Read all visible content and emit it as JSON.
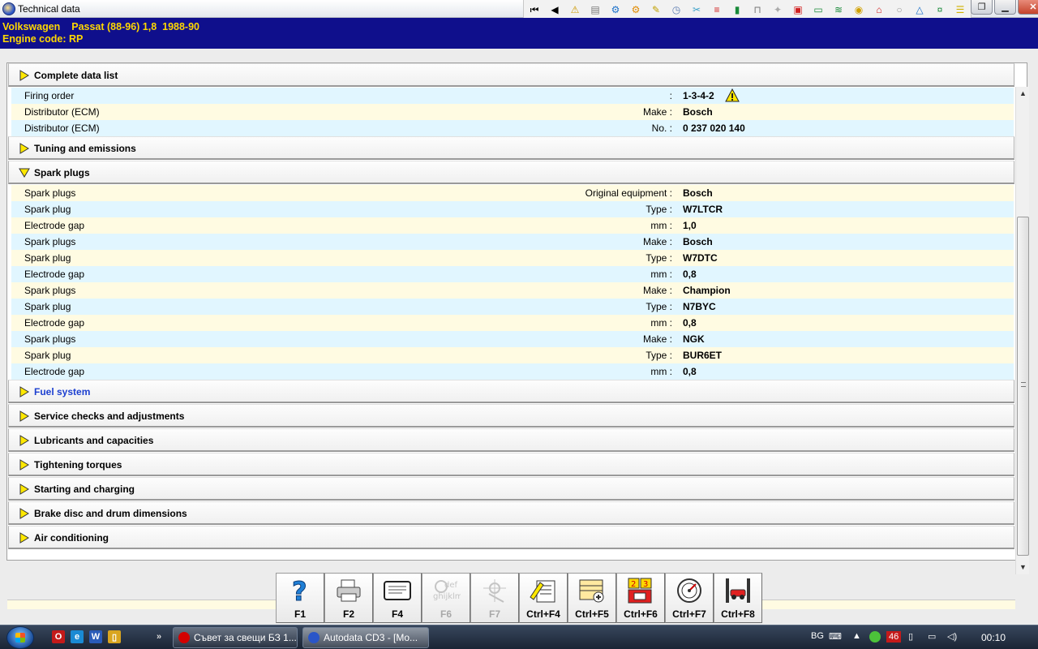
{
  "window": {
    "title": "Technical data"
  },
  "top_toolbar": {
    "buttons": [
      {
        "icon": "first-page-icon",
        "glyph": "⏮"
      },
      {
        "icon": "previous-icon",
        "glyph": "◀"
      },
      {
        "icon": "warning-triangle-icon",
        "glyph": "⚠"
      },
      {
        "icon": "page-icon",
        "glyph": "▤"
      },
      {
        "icon": "engine-icon",
        "glyph": "⚙"
      },
      {
        "icon": "gear-icon",
        "glyph": "⚙"
      },
      {
        "icon": "wrench-icon",
        "glyph": "✎"
      },
      {
        "icon": "clock-icon",
        "glyph": "◷"
      },
      {
        "icon": "tools-icon",
        "glyph": "✂"
      },
      {
        "icon": "belt-icon",
        "glyph": "≡"
      },
      {
        "icon": "battery-icon",
        "glyph": "▮"
      },
      {
        "icon": "lift-icon",
        "glyph": "⊓"
      },
      {
        "icon": "spark-plug-icon",
        "glyph": "✦"
      },
      {
        "icon": "diagnostics-icon",
        "glyph": "▣"
      },
      {
        "icon": "dashboard-icon",
        "glyph": "▭"
      },
      {
        "icon": "coolant-icon",
        "glyph": "≋"
      },
      {
        "icon": "emissions-icon",
        "glyph": "◉"
      },
      {
        "icon": "car-service-icon",
        "glyph": "⌂"
      },
      {
        "icon": "tyre-icon",
        "glyph": "○"
      },
      {
        "icon": "airbag-icon",
        "glyph": "△"
      },
      {
        "icon": "money-icon",
        "glyph": "¤"
      },
      {
        "icon": "notes-icon",
        "glyph": "☰"
      }
    ]
  },
  "window_controls": {
    "restore": "❐",
    "minimize": "▁",
    "close": "✕"
  },
  "vehicle": {
    "make": "Volkswagen",
    "model": "Passat (88-96) 1,8",
    "years": "1988-90",
    "engine_code": "Engine code: RP"
  },
  "sections": {
    "complete_data_list": "Complete data list",
    "tuning": "Tuning and emissions",
    "spark_plugs": "Spark plugs",
    "fuel_system": "Fuel system",
    "service_checks": "Service checks and adjustments",
    "lubricants": "Lubricants and capacities",
    "tightening": "Tightening torques",
    "starting": "Starting and charging",
    "brake": "Brake disc and drum dimensions",
    "air_con": "Air conditioning"
  },
  "ignition_rows": [
    {
      "name": "Firing order",
      "unit": ":",
      "value": "1-3-4-2",
      "warning": true
    },
    {
      "name": "Distributor (ECM)",
      "unit": "Make :",
      "value": "Bosch"
    },
    {
      "name": "Distributor (ECM)",
      "unit": "No. :",
      "value": "0 237 020 140"
    }
  ],
  "spark_plug_rows": [
    {
      "name": "Spark plugs",
      "unit": "Original equipment :",
      "value": "Bosch"
    },
    {
      "name": "Spark plug",
      "unit": "Type :",
      "value": "W7LTCR"
    },
    {
      "name": "Electrode gap",
      "unit": "mm :",
      "value": "1,0"
    },
    {
      "name": "Spark plugs",
      "unit": "Make :",
      "value": "Bosch"
    },
    {
      "name": "Spark plug",
      "unit": "Type :",
      "value": "W7DTC"
    },
    {
      "name": "Electrode gap",
      "unit": "mm :",
      "value": "0,8"
    },
    {
      "name": "Spark plugs",
      "unit": "Make :",
      "value": "Champion"
    },
    {
      "name": "Spark plug",
      "unit": "Type :",
      "value": "N7BYC"
    },
    {
      "name": "Electrode gap",
      "unit": "mm :",
      "value": "0,8"
    },
    {
      "name": "Spark plugs",
      "unit": "Make :",
      "value": "NGK"
    },
    {
      "name": "Spark plug",
      "unit": "Type :",
      "value": "BUR6ET"
    },
    {
      "name": "Electrode gap",
      "unit": "mm :",
      "value": "0,8"
    }
  ],
  "function_bar": {
    "f1": "F1",
    "f2": "F2",
    "f4": "F4",
    "f6": "F6",
    "f7": "F7",
    "ctrl_f4": "Ctrl+F4",
    "ctrl_f5": "Ctrl+F5",
    "ctrl_f6": "Ctrl+F6",
    "ctrl_f7": "Ctrl+F7",
    "ctrl_f8": "Ctrl+F8",
    "f6_icon_text": "def",
    "f6_icon_text2": "ghijklm",
    "ctrl_f6_cell_a": "2",
    "ctrl_f6_cell_b": "3"
  },
  "taskbar": {
    "quicklaunch": [
      "O",
      "e",
      "W",
      "▯"
    ],
    "more": "»",
    "tasks": [
      {
        "label": "Съвет за свещи БЗ 1..."
      },
      {
        "label": "Autodata CD3 - [Mo..."
      }
    ],
    "language": "BG",
    "badge": "46",
    "clock": "00:10"
  },
  "colors": {
    "header_bg": "#0f0f8c",
    "header_text": "#ffd800",
    "row_blue": "#e1f6ff",
    "row_cream": "#fffbe2",
    "link": "#1c3fd0"
  }
}
